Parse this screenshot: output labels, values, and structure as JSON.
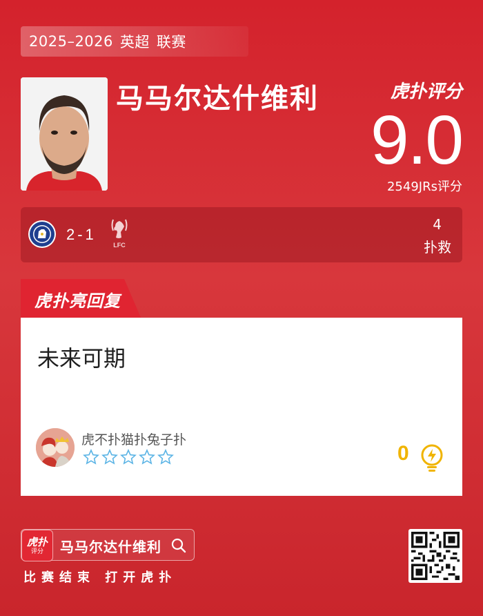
{
  "header": {
    "season": "2025–2026",
    "league": "英超",
    "competition": "联赛"
  },
  "player": {
    "name": "马马尔达什维利"
  },
  "rating": {
    "brand": "虎扑评分",
    "score": "9.0",
    "count_label": "2549JRs评分"
  },
  "match": {
    "home_team_icon": "chelsea-crest-icon",
    "score": "2-1",
    "away_team_icon": "liverpool-crest-icon",
    "stat_value": "4",
    "stat_label": "扑救"
  },
  "reply": {
    "tab_label": "虎扑亮回复",
    "text": "未来可期",
    "user": "虎不扑猫扑兔子扑",
    "stars_filled": 0,
    "stars_total": 5,
    "likes": "0"
  },
  "footer": {
    "app_icon_top": "虎扑",
    "app_icon_sub": "评分",
    "search_text": "马马尔达什维利",
    "cta": "比赛结束 打开虎扑"
  },
  "colors": {
    "background": "#d4222c",
    "accent_like": "#f0b400",
    "star_outline": "#5bb4e5"
  }
}
